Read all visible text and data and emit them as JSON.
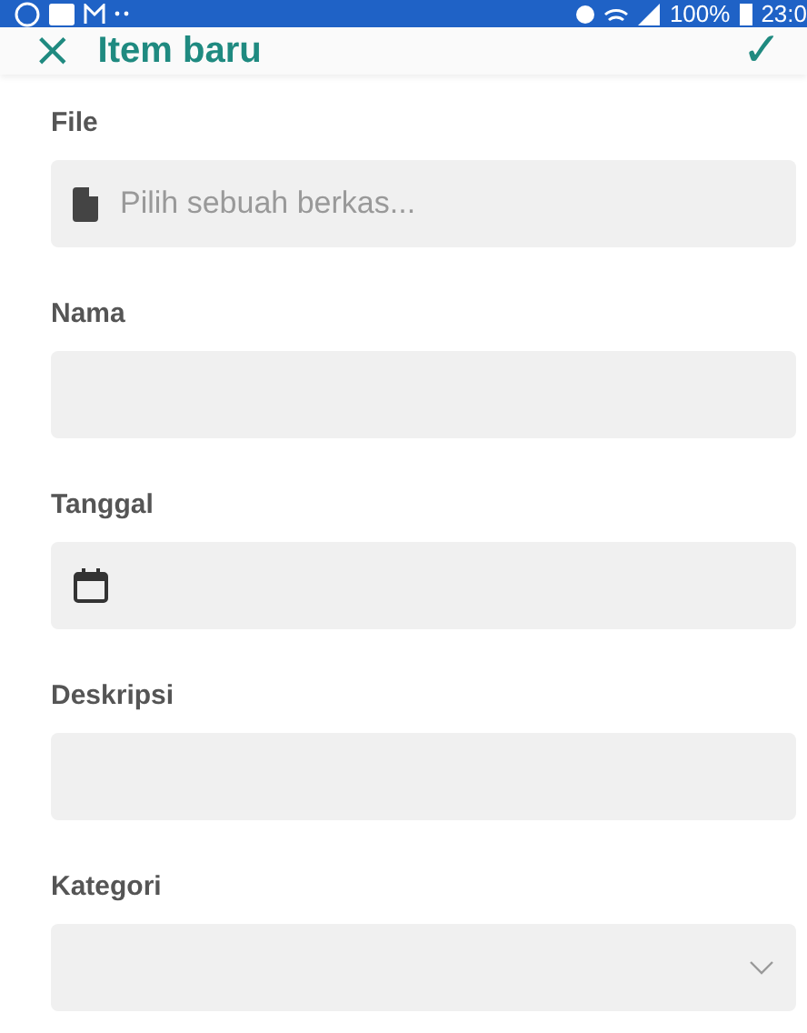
{
  "status_bar": {
    "battery": "100%",
    "time": "23:0"
  },
  "header": {
    "close": "×",
    "title": "Item baru",
    "confirm": "✓"
  },
  "fields": [
    {
      "label": "File",
      "kind": "file",
      "placeholder": "Pilih sebuah berkas..."
    },
    {
      "label": "Nama",
      "kind": "text"
    },
    {
      "label": "Tanggal",
      "kind": "date"
    },
    {
      "label": "Deskripsi",
      "kind": "text"
    },
    {
      "label": "Kategori",
      "kind": "select"
    }
  ]
}
